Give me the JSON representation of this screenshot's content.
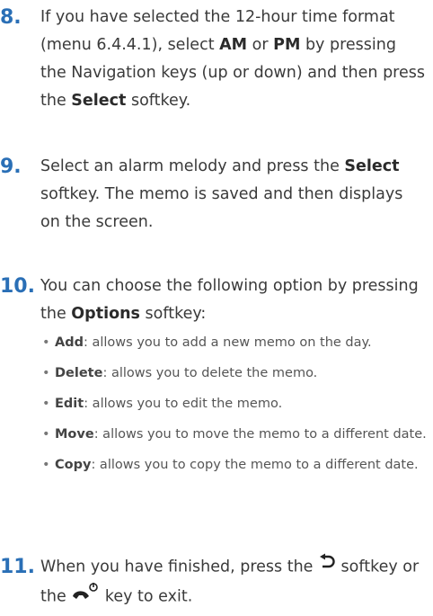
{
  "step8": {
    "number": "8.",
    "t1": "If you have selected the 12-hour time format (menu 6.4.4.1), select ",
    "b1": "AM",
    "t2": " or ",
    "b2": "PM",
    "t3": " by pressing the Navigation keys (up or down) and then press the ",
    "b3": "Select",
    "t4": " softkey."
  },
  "step9": {
    "number": "9.",
    "t1": "Select an alarm melody and press the ",
    "b1": "Select",
    "t2": " softkey. The memo is saved and then displays on the screen."
  },
  "step10": {
    "number": "10.",
    "t1": "You can choose the following option by pressing the ",
    "b1": "Options",
    "t2": " softkey:",
    "items": [
      {
        "bullet": "•",
        "term": "Add",
        "desc": ": allows you to add a new memo on the day."
      },
      {
        "bullet": "•",
        "term": "Delete",
        "desc": ": allows you to delete the memo."
      },
      {
        "bullet": "•",
        "term": "Edit",
        "desc": ": allows you to edit the memo."
      },
      {
        "bullet": "•",
        "term": "Move",
        "desc": ": allows you to move the memo to a different date."
      },
      {
        "bullet": "•",
        "term": "Copy",
        "desc": ": allows you to copy the memo to a different date."
      }
    ]
  },
  "step11": {
    "number": "11.",
    "t1": "When you have finished, press the ",
    "t2": " softkey or the ",
    "t3": " key to exit.",
    "back_icon": "back-arrow-icon",
    "end_icon": "end-power-key-icon"
  },
  "colors": {
    "number": "#2a6fb6",
    "text": "#3a3a3a"
  }
}
